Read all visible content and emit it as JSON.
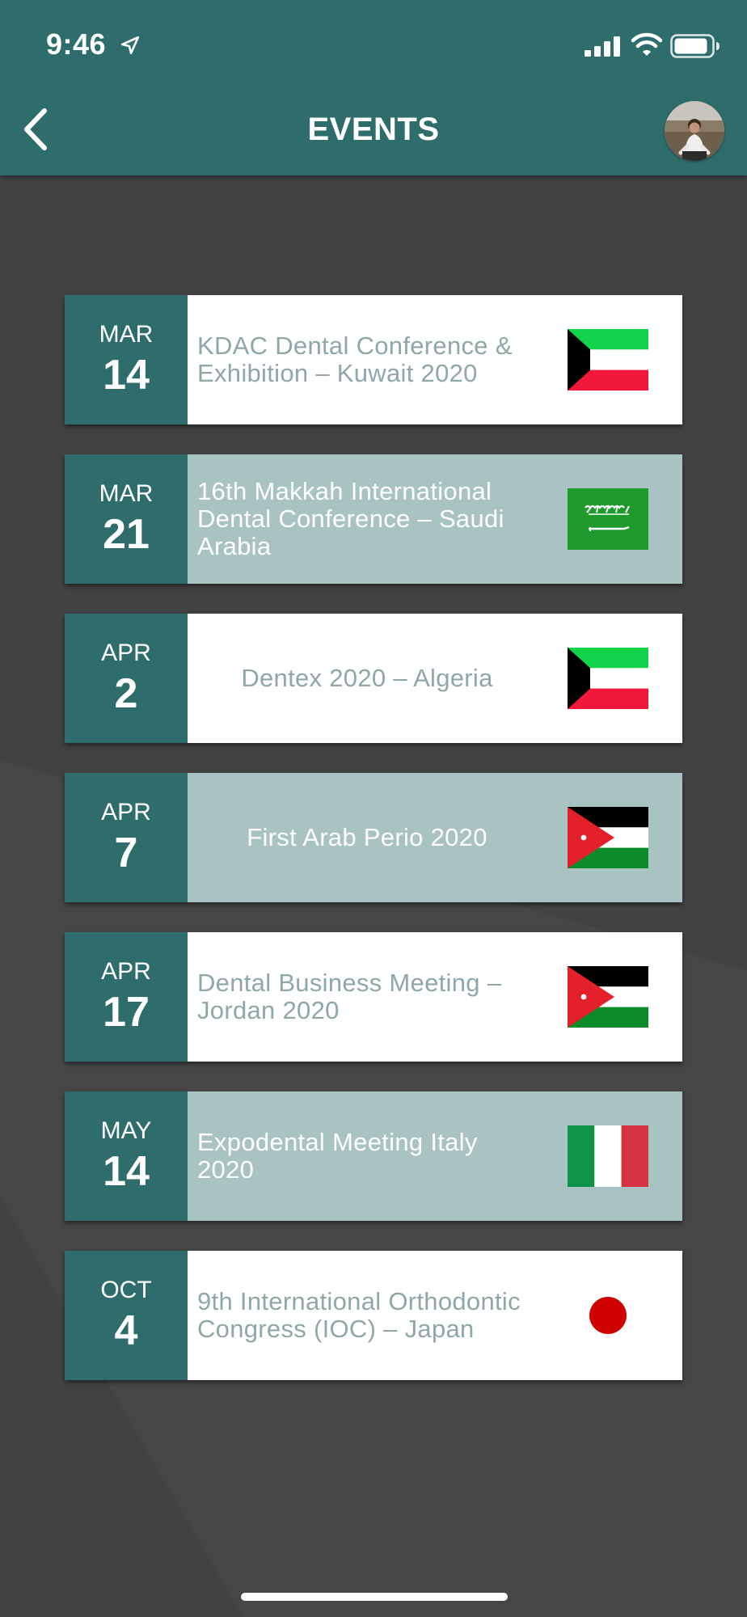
{
  "status_bar": {
    "time": "9:46",
    "icons": [
      "location-arrow-icon",
      "cellular-signal-icon",
      "wifi-icon",
      "battery-icon"
    ]
  },
  "header": {
    "title": "EVENTS",
    "back_icon": "chevron-left-icon",
    "avatar": "user-avatar"
  },
  "colors": {
    "header_bg": "#2f6d6c",
    "date_block_bg": "#2f6d6c",
    "card_light_bg": "#ffffff",
    "card_dark_bg": "#a9c3c3",
    "light_text": "#8fa7a7",
    "page_bg": "#3f3f3f"
  },
  "events": [
    {
      "month": "MAR",
      "day": "14",
      "title": "KDAC Dental Conference & Exhibition – Kuwait 2020",
      "flag": "kuwait-flag",
      "style": "light",
      "align": "left"
    },
    {
      "month": "MAR",
      "day": "21",
      "title": "16th Makkah International Dental Conference – Saudi Arabia",
      "flag": "saudi-arabia-flag",
      "style": "dark",
      "align": "left"
    },
    {
      "month": "APR",
      "day": "2",
      "title": "Dentex 2020 – Algeria",
      "flag": "kuwait-flag",
      "style": "light",
      "align": "center"
    },
    {
      "month": "APR",
      "day": "7",
      "title": "First Arab Perio 2020",
      "flag": "jordan-flag",
      "style": "dark",
      "align": "center"
    },
    {
      "month": "APR",
      "day": "17",
      "title": "Dental Business Meeting – Jordan 2020",
      "flag": "jordan-flag",
      "style": "light",
      "align": "left"
    },
    {
      "month": "MAY",
      "day": "14",
      "title": "Expodental Meeting Italy 2020",
      "flag": "italy-flag",
      "style": "dark",
      "align": "left"
    },
    {
      "month": "OCT",
      "day": "4",
      "title": "9th International Orthodontic Congress (IOC) – Japan",
      "flag": "japan-flag",
      "style": "light",
      "align": "left"
    }
  ]
}
